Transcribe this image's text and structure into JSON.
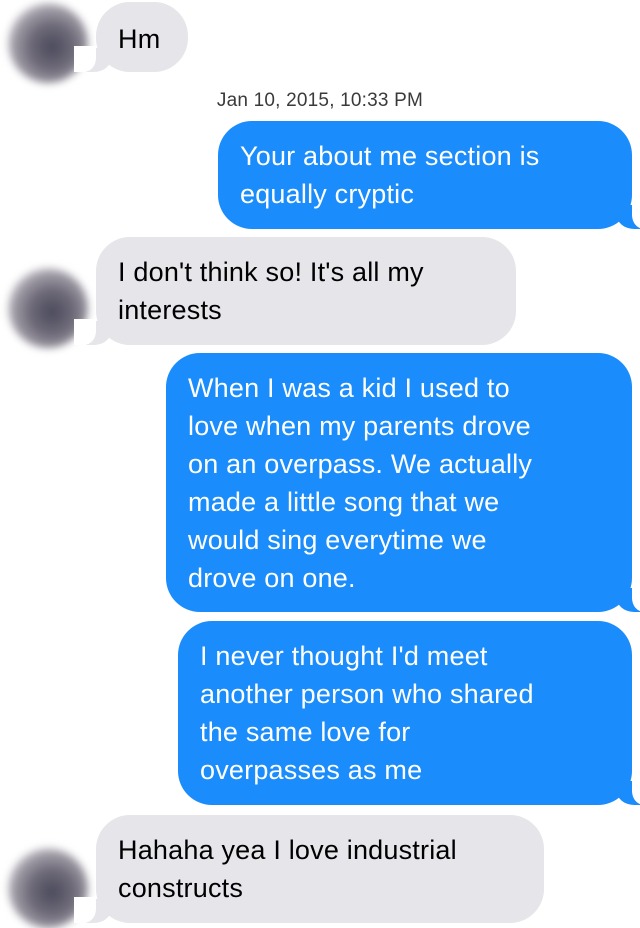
{
  "conversation": {
    "timestamp": "Jan 10, 2015, 10:33 PM",
    "messages": [
      {
        "direction": "received",
        "text": "Hm"
      },
      {
        "direction": "sent",
        "text": "Your about me section is\nequally cryptic"
      },
      {
        "direction": "received",
        "text": "I don't think so! It's all my\ninterests"
      },
      {
        "direction": "sent",
        "text": "When I was a kid I used to\nlove when my parents drove\non an overpass. We actually\nmade a little song that we\nwould sing everytime we\ndrove on one."
      },
      {
        "direction": "sent",
        "text": "I never thought I'd meet\nanother person who shared\nthe same love for\noverpasses as me"
      },
      {
        "direction": "received",
        "text": "Hahaha yea I love industrial\nconstructs"
      }
    ]
  },
  "colors": {
    "sent_bubble": "#1a8cfb",
    "received_bubble": "#e5e5ea",
    "sent_text": "#ffffff",
    "received_text": "#000000",
    "timestamp_text": "#3a3a3c"
  },
  "icons": {
    "avatar": "contact-avatar (blurred)"
  }
}
